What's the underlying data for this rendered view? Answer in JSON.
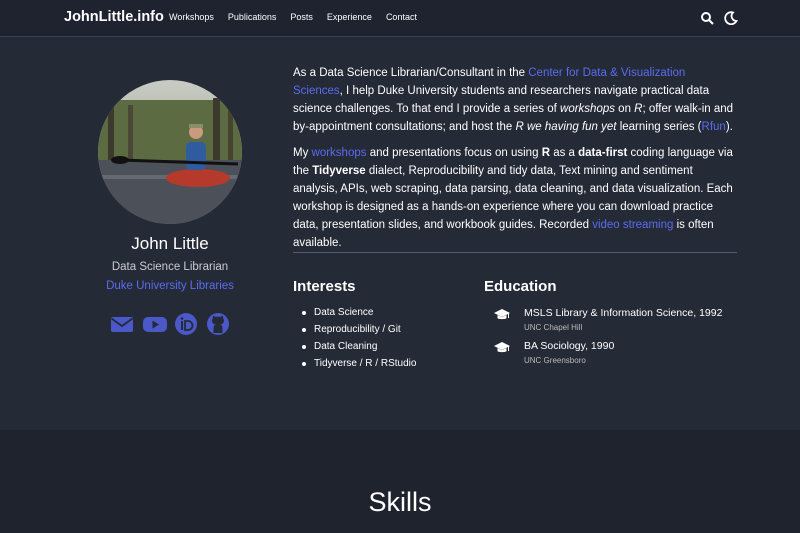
{
  "brand": "JohnLittle.info",
  "nav": {
    "items": [
      "Workshops",
      "Publications",
      "Posts",
      "Experience",
      "Contact"
    ]
  },
  "icons": {
    "search": "search-icon",
    "theme": "moon-icon"
  },
  "profile": {
    "name": "John Little",
    "role": "Data Science Librarian",
    "org": "Duke University Libraries",
    "socials": [
      "envelope-icon",
      "youtube-icon",
      "orcid-icon",
      "github-icon"
    ]
  },
  "bio": {
    "p1_a": "As a Data Science Librarian/Consultant in the ",
    "p1_link": "Center for Data & Visualization Sciences",
    "p1_b": ", I help Duke University students and researchers navigate practical data science challenges. To that end I provide a series of ",
    "p1_em1": "workshops",
    "p1_c": " on ",
    "p1_em2": "R",
    "p1_d": "; offer walk-in and by-appointment consultations; and host the ",
    "p1_em3": "R we having fun yet",
    "p1_e": " learning series (",
    "p1_link2": "Rfun",
    "p1_f": ").",
    "p2_a": "My ",
    "p2_link": "workshops",
    "p2_b": " and presentations focus on using ",
    "p2_bold1": "R",
    "p2_c": " as a ",
    "p2_bold2": "data-first",
    "p2_d": " coding language via the ",
    "p2_bold3": "Tidyverse",
    "p2_e": " dialect, Reproducibility and tidy data, Text mining and sentiment analysis, APIs, web scraping, data parsing, data cleaning, and data visualization. Each workshop is designed as a hands-on experience where you can download practice data, presentation slides, and workbook guides. Recorded ",
    "p2_link2": "video streaming",
    "p2_f": " is often available."
  },
  "interests": {
    "title": "Interests",
    "items": [
      "Data Science",
      "Reproducibility / Git",
      "Data Cleaning",
      "Tidyverse / R / RStudio"
    ]
  },
  "education": {
    "title": "Education",
    "items": [
      {
        "degree": "MSLS Library & Information Science, 1992",
        "school": "UNC Chapel Hill"
      },
      {
        "degree": "BA Sociology, 1990",
        "school": "UNC Greensboro"
      }
    ]
  },
  "skills": {
    "title": "Skills"
  },
  "colors": {
    "bg": "#252a37",
    "nav_bg": "#1f2330",
    "accent": "#5b6cf0",
    "band_bg": "#1f232e"
  }
}
